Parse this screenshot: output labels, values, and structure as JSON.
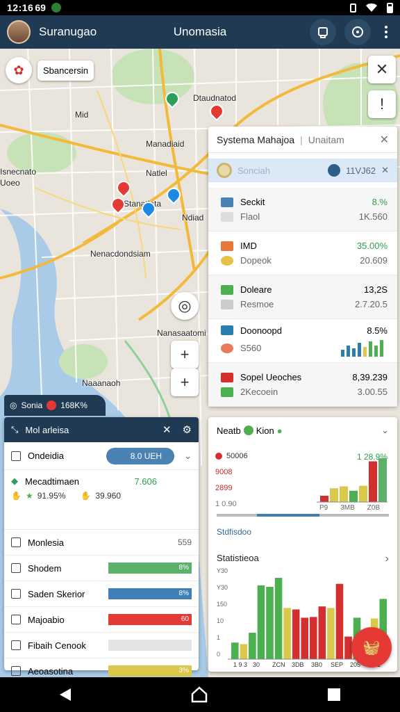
{
  "status": {
    "time": "12:16",
    "carrier": "69"
  },
  "appbar": {
    "app_title": "Suranugao",
    "center_title": "Unomasia"
  },
  "search": {
    "label": "Sbancersin"
  },
  "map_labels": [
    {
      "text": "Dtaudnatod"
    },
    {
      "text": "Mid"
    },
    {
      "text": "Manadiaid"
    },
    {
      "text": "Natlel"
    },
    {
      "text": "Stanatlata"
    },
    {
      "text": "Ndiad"
    },
    {
      "text": "Nenacdondsiam"
    },
    {
      "text": "Nanasaatomi"
    },
    {
      "text": "Naaanaoh"
    },
    {
      "text": "Isnecnato"
    },
    {
      "text": "Uoeo"
    }
  ],
  "summary": {
    "title": "Systema Mahajoa",
    "subtitle": "Unaitam",
    "selector_left": "Sonciah",
    "selector_right": "11VJ62",
    "rows": [
      {
        "name": "Seckit",
        "sub": "Flaol",
        "value": "8.%",
        "value2": "1K.560",
        "color": "#2e9e4a",
        "icon": "#4a82b4"
      },
      {
        "name": "IMD",
        "sub": "Dopeok",
        "value": "35.00%",
        "value2": "20.609",
        "color": "#2e9e4a",
        "icon": "#e6793a"
      },
      {
        "name": "Doleare",
        "sub": "Resmoe",
        "value": "13,2S",
        "value2": "2.7.20.5",
        "color": "#222",
        "icon": "#4caf50"
      },
      {
        "name": "Doonoopd",
        "sub": "S560",
        "value": "8.5%",
        "value2": "",
        "color": "#222",
        "icon": "#2a7fb0"
      },
      {
        "name": "Sopel Ueoches",
        "sub": "2Kecoein",
        "value": "8,39.239",
        "value2": "3.00.55",
        "color": "#222",
        "icon": "#d32f2f"
      }
    ]
  },
  "filter": {
    "tab_label": "Sonia",
    "tab_value": "168K%",
    "title": "Mol arleisa",
    "select_label": "Ondeidia",
    "select_value": "8.0 UEH",
    "meta_title": "Mecadtimaen",
    "meta_value": "7.606",
    "meta_b1": "91.95%",
    "meta_b2": "39.960",
    "rows": [
      {
        "label": "Monlesia",
        "pct": 0,
        "text": "559",
        "color": "#e3e3e3"
      },
      {
        "label": "Shodem",
        "pct": 100,
        "text": "8%",
        "color": "#5bb06a"
      },
      {
        "label": "Saden Skerior",
        "pct": 100,
        "text": "8%",
        "color": "#3f7fb5"
      },
      {
        "label": "Majoabio",
        "pct": 100,
        "text": "60",
        "color": "#e53935"
      },
      {
        "label": "Fibaih Cenook",
        "pct": 0,
        "text": "",
        "color": "#e3e3e3"
      },
      {
        "label": "Aeoasotina",
        "pct": 100,
        "text": "3%",
        "color": "#d9c84a"
      }
    ]
  },
  "near": {
    "title": "Neatb",
    "title2": "Kion",
    "legend": [
      "50006",
      "9008",
      "2899",
      "1 0.90"
    ],
    "value": "1 28.9%",
    "axis": [
      "P9",
      "3MB",
      "Z0B"
    ],
    "stat1": "Stdfisdoo",
    "stat2": "Statistieoa",
    "yticks": [
      "Y30",
      "Y30",
      "150",
      "10",
      "1",
      "0"
    ],
    "xticks": [
      "1 9 3",
      "30",
      "ZCN",
      "3DB",
      "3B0",
      "SEP",
      "205",
      "1S1"
    ]
  },
  "chart_data": [
    {
      "type": "bar",
      "title": "",
      "xlabel": "",
      "ylabel": "",
      "categories": [
        "1",
        "2",
        "3",
        "4",
        "5",
        "6",
        "7"
      ],
      "values": [
        10,
        22,
        25,
        18,
        26,
        65,
        70
      ],
      "colors": [
        "#d32f2f",
        "#d9c84a",
        "#d9c84a",
        "#4caf50",
        "#d9c84a",
        "#d32f2f",
        "#5bb06a"
      ],
      "ylim": [
        0,
        80
      ]
    },
    {
      "type": "bar",
      "title": "",
      "xlabel": "",
      "ylabel": "",
      "categories": [
        "a",
        "b",
        "c",
        "d",
        "e",
        "f",
        "g",
        "h",
        "i",
        "j",
        "k",
        "l",
        "m",
        "n",
        "o",
        "p",
        "q",
        "r"
      ],
      "values": [
        22,
        20,
        35,
        98,
        96,
        108,
        68,
        66,
        55,
        56,
        70,
        68,
        100,
        30,
        55,
        38,
        54,
        80
      ],
      "colors": [
        "#4caf50",
        "#d9c84a",
        "#4caf50",
        "#4caf50",
        "#4caf50",
        "#4caf50",
        "#d9c84a",
        "#d32f2f",
        "#d32f2f",
        "#d32f2f",
        "#d32f2f",
        "#d9c84a",
        "#d32f2f",
        "#d32f2f",
        "#4caf50",
        "#4caf50",
        "#d9c84a",
        "#4caf50"
      ],
      "ylim": [
        0,
        120
      ]
    }
  ]
}
